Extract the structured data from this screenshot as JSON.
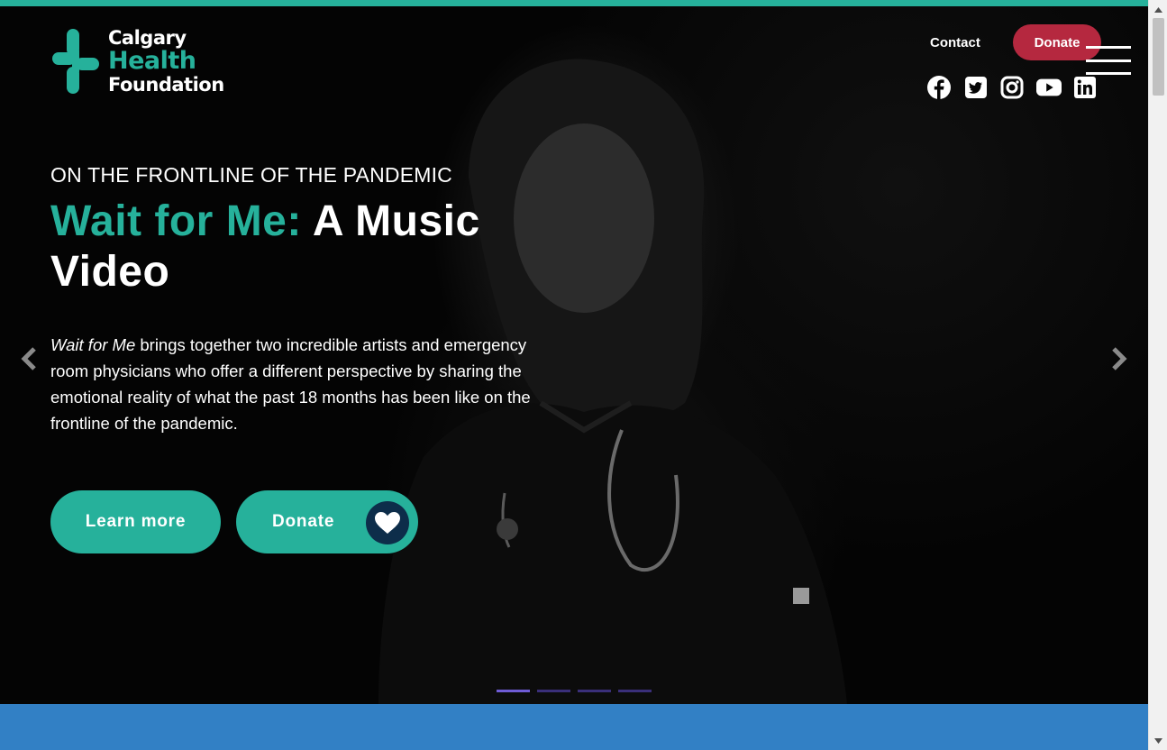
{
  "brand": {
    "line1": "Calgary",
    "line2": "Health",
    "line3": "Foundation"
  },
  "colors": {
    "accent": "#26b19b",
    "donate_pill": "#b5283f",
    "heart_circle": "#0d2d4a",
    "blue_band": "#3280c5",
    "indicator_active": "#6f5cd6",
    "indicator": "#3a2f7a"
  },
  "nav": {
    "contact_label": "Contact",
    "donate_label": "Donate",
    "menu_icon": "hamburger-icon"
  },
  "social": [
    "facebook-icon",
    "twitter-icon",
    "instagram-icon",
    "youtube-icon",
    "linkedin-icon"
  ],
  "hero": {
    "eyebrow": "ON THE FRONTLINE OF THE PANDEMIC",
    "headline_accent": "Wait for Me:",
    "headline_rest": " A Music Video",
    "intro_em": "Wait for Me",
    "intro_rest": " brings together two incredible artists and emergency room physicians who offer a different perspective by sharing the emotional reality of what the past 18 months has been like on the frontline of the pandemic.",
    "learn_more_label": "Learn more",
    "donate_label": "Donate",
    "slide_count": 4,
    "active_slide": 1
  }
}
